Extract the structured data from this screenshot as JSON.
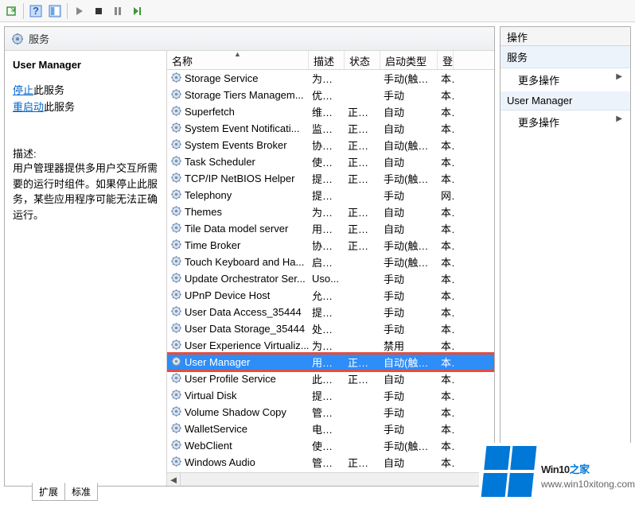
{
  "toolbar": {},
  "left": {
    "header_title": "服务",
    "detail": {
      "service_name": "User Manager",
      "link_stop_pre": "停止",
      "link_stop_post": "此服务",
      "link_restart_pre": "重启动",
      "link_restart_post": "此服务",
      "desc_label": "描述:",
      "desc_text": "用户管理器提供多用户交互所需要的运行时组件。如果停止此服务，某些应用程序可能无法正确运行。"
    },
    "columns": {
      "name": "名称",
      "desc": "描述",
      "status": "状态",
      "start": "启动类型",
      "logon": "登"
    },
    "rows": [
      {
        "name": "Storage Service",
        "desc": "为存...",
        "status": "",
        "start": "手动(触发...",
        "logon": "本"
      },
      {
        "name": "Storage Tiers Managem...",
        "desc": "优化...",
        "status": "",
        "start": "手动",
        "logon": "本"
      },
      {
        "name": "Superfetch",
        "desc": "维护...",
        "status": "正在...",
        "start": "自动",
        "logon": "本"
      },
      {
        "name": "System Event Notificati...",
        "desc": "监视...",
        "status": "正在...",
        "start": "自动",
        "logon": "本"
      },
      {
        "name": "System Events Broker",
        "desc": "协调...",
        "status": "正在...",
        "start": "自动(触发...",
        "logon": "本"
      },
      {
        "name": "Task Scheduler",
        "desc": "使用...",
        "status": "正在...",
        "start": "自动",
        "logon": "本"
      },
      {
        "name": "TCP/IP NetBIOS Helper",
        "desc": "提供...",
        "status": "正在...",
        "start": "手动(触发...",
        "logon": "本"
      },
      {
        "name": "Telephony",
        "desc": "提供...",
        "status": "",
        "start": "手动",
        "logon": "网"
      },
      {
        "name": "Themes",
        "desc": "为用...",
        "status": "正在...",
        "start": "自动",
        "logon": "本"
      },
      {
        "name": "Tile Data model server",
        "desc": "用于...",
        "status": "正在...",
        "start": "自动",
        "logon": "本"
      },
      {
        "name": "Time Broker",
        "desc": "协调...",
        "status": "正在...",
        "start": "手动(触发...",
        "logon": "本"
      },
      {
        "name": "Touch Keyboard and Ha...",
        "desc": "启用...",
        "status": "",
        "start": "手动(触发...",
        "logon": "本"
      },
      {
        "name": "Update Orchestrator Ser...",
        "desc": "Uso...",
        "status": "",
        "start": "手动",
        "logon": "本"
      },
      {
        "name": "UPnP Device Host",
        "desc": "允许...",
        "status": "",
        "start": "手动",
        "logon": "本"
      },
      {
        "name": "User Data Access_35444",
        "desc": "提供...",
        "status": "",
        "start": "手动",
        "logon": "本"
      },
      {
        "name": "User Data Storage_35444",
        "desc": "处理...",
        "status": "",
        "start": "手动",
        "logon": "本"
      },
      {
        "name": "User Experience Virtualiz...",
        "desc": "为应...",
        "status": "",
        "start": "禁用",
        "logon": "本"
      },
      {
        "name": "User Manager",
        "desc": "用户...",
        "status": "正在...",
        "start": "自动(触发...",
        "logon": "本",
        "selected": true
      },
      {
        "name": "User Profile Service",
        "desc": "此服...",
        "status": "正在...",
        "start": "自动",
        "logon": "本"
      },
      {
        "name": "Virtual Disk",
        "desc": "提供...",
        "status": "",
        "start": "手动",
        "logon": "本"
      },
      {
        "name": "Volume Shadow Copy",
        "desc": "管理...",
        "status": "",
        "start": "手动",
        "logon": "本"
      },
      {
        "name": "WalletService",
        "desc": "电子...",
        "status": "",
        "start": "手动",
        "logon": "本"
      },
      {
        "name": "WebClient",
        "desc": "使基...",
        "status": "",
        "start": "手动(触发...",
        "logon": "本"
      },
      {
        "name": "Windows Audio",
        "desc": "管理...",
        "status": "正在...",
        "start": "自动",
        "logon": "本"
      }
    ],
    "tab_extended": "扩展",
    "tab_standard": "标准"
  },
  "right": {
    "header": "操作",
    "section1": "服务",
    "item1": "更多操作",
    "section2": "User Manager",
    "item2": "更多操作"
  },
  "watermark": {
    "brand1": "Win10",
    "brand2": "之家",
    "url": "www.win10xitong.com"
  }
}
